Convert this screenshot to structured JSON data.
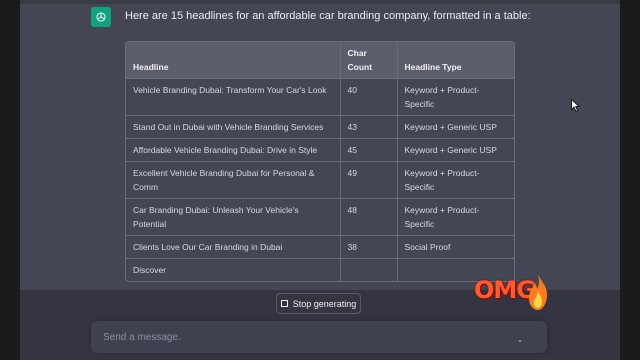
{
  "message": {
    "intro": "Here are 15 headlines for an affordable car branding company, formatted in a table:"
  },
  "table": {
    "headers": {
      "headline": "Headline",
      "char_count": "Char Count",
      "type": "Headline Type"
    },
    "rows": [
      {
        "headline": "Vehicle Branding Dubai: Transform Your Car's Look",
        "count": "40",
        "type": "Keyword + Product-Specific"
      },
      {
        "headline": "Stand Out in Dubai with Vehicle Branding Services",
        "count": "43",
        "type": "Keyword + Generic USP"
      },
      {
        "headline": "Affordable Vehicle Branding Dubai: Drive in Style",
        "count": "45",
        "type": "Keyword + Generic USP"
      },
      {
        "headline": "Excellent Vehicle Branding Dubai for Personal & Comm",
        "count": "49",
        "type": "Keyword + Product-Specific"
      },
      {
        "headline": "Car Branding Dubai: Unleash Your Vehicle's Potential",
        "count": "48",
        "type": "Keyword + Product-Specific"
      },
      {
        "headline": "Clients Love Our Car Branding in Dubai",
        "count": "38",
        "type": "Social Proof"
      },
      {
        "headline": "Discover",
        "count": "",
        "type": ""
      }
    ]
  },
  "controls": {
    "stop_label": "Stop generating"
  },
  "composer": {
    "placeholder": "Send a message."
  },
  "overlay": {
    "sticker_text": "OMG"
  },
  "colors": {
    "brand": "#10a37f",
    "sticker": "#ff5a2a"
  }
}
